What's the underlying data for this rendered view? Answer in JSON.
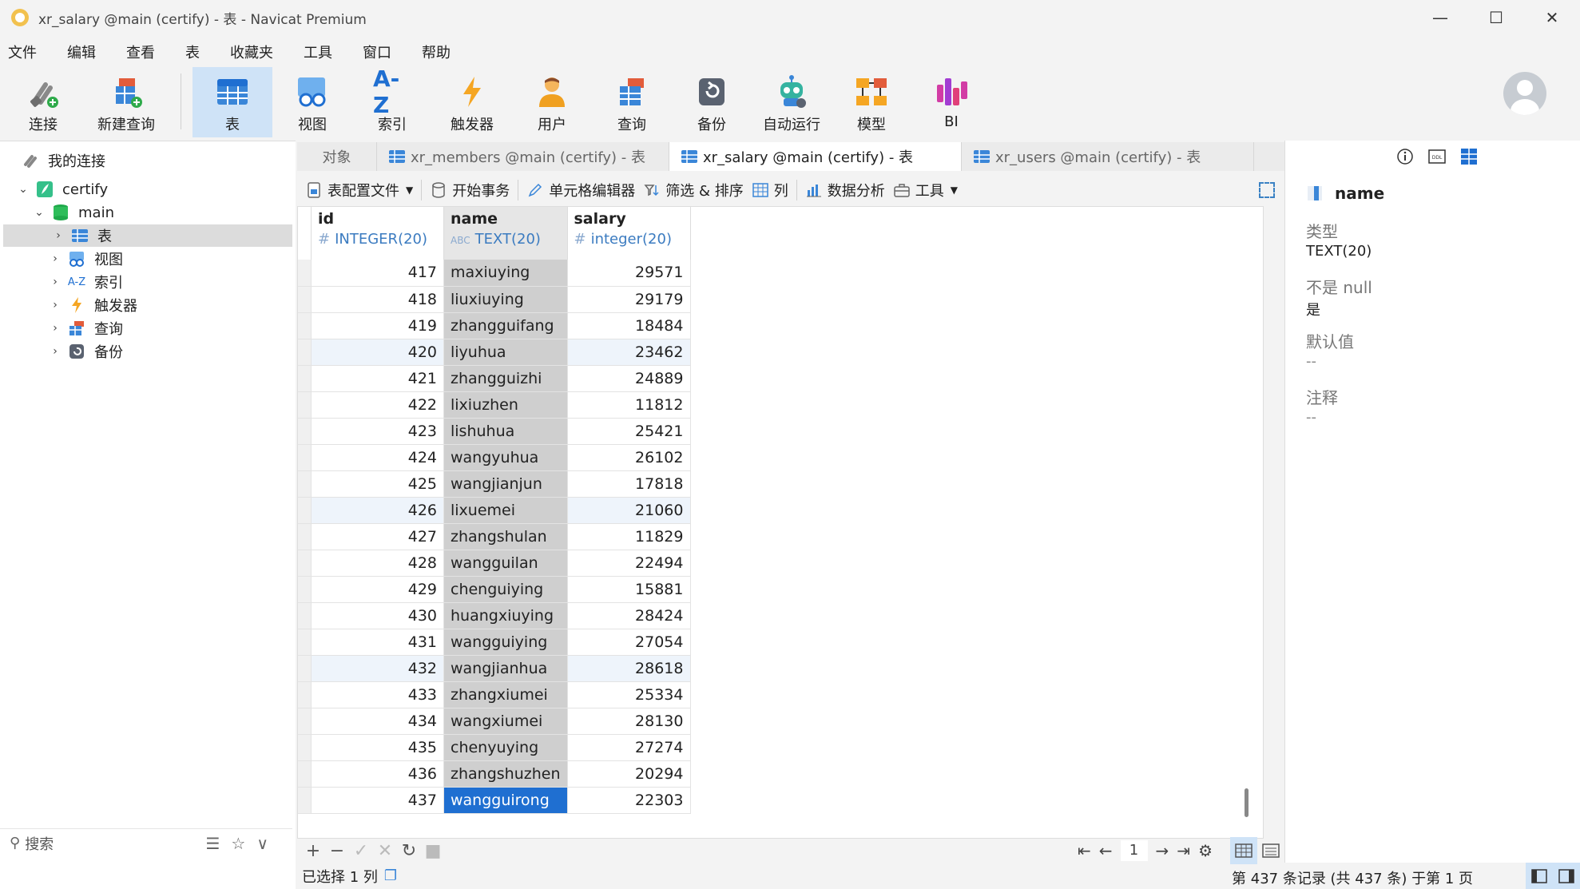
{
  "window": {
    "title": "xr_salary @main (certify) - 表 - Navicat Premium"
  },
  "menu": [
    "文件",
    "编辑",
    "查看",
    "表",
    "收藏夹",
    "工具",
    "窗口",
    "帮助"
  ],
  "toolbar": {
    "connect": "连接",
    "new_query": "新建查询",
    "table": "表",
    "view": "视图",
    "index": "索引",
    "trigger": "触发器",
    "user": "用户",
    "query": "查询",
    "backup": "备份",
    "automation": "自动运行",
    "model": "模型",
    "bi": "BI",
    "index_icon_text": "A-Z"
  },
  "sidebar": {
    "my_connections": "我的连接",
    "connection": "certify",
    "database": "main",
    "items": [
      {
        "label": "表"
      },
      {
        "label": "视图"
      },
      {
        "label": "索引"
      },
      {
        "label": "触发器"
      },
      {
        "label": "查询"
      },
      {
        "label": "备份"
      }
    ],
    "index_icon_text": "A-Z",
    "search_placeholder": "搜索"
  },
  "tabs": {
    "objects": "对象",
    "items": [
      {
        "label": "xr_members @main (certify) - 表"
      },
      {
        "label": "xr_salary @main (certify) - 表"
      },
      {
        "label": "xr_users @main (certify) - 表"
      }
    ]
  },
  "table_toolbar": {
    "config": "表配置文件",
    "begin_tx": "开始事务",
    "cell_editor": "单元格编辑器",
    "filter_sort": "筛选 & 排序",
    "columns": "列",
    "analysis": "数据分析",
    "tools": "工具"
  },
  "grid": {
    "columns": [
      {
        "name": "id",
        "type": "INTEGER(20)",
        "glyph": "#"
      },
      {
        "name": "name",
        "type": "TEXT(20)",
        "glyph": "ABC"
      },
      {
        "name": "salary",
        "type": "integer(20)",
        "glyph": "#"
      }
    ],
    "rows": [
      {
        "id": "417",
        "name": "maxiuying",
        "salary": "29571"
      },
      {
        "id": "418",
        "name": "liuxiuying",
        "salary": "29179"
      },
      {
        "id": "419",
        "name": "zhangguifang",
        "salary": "18484"
      },
      {
        "id": "420",
        "name": "liyuhua",
        "salary": "23462"
      },
      {
        "id": "421",
        "name": "zhangguizhi",
        "salary": "24889"
      },
      {
        "id": "422",
        "name": "lixiuzhen",
        "salary": "11812"
      },
      {
        "id": "423",
        "name": "lishuhua",
        "salary": "25421"
      },
      {
        "id": "424",
        "name": "wangyuhua",
        "salary": "26102"
      },
      {
        "id": "425",
        "name": "wangjianjun",
        "salary": "17818"
      },
      {
        "id": "426",
        "name": "lixuemei",
        "salary": "21060"
      },
      {
        "id": "427",
        "name": "zhangshulan",
        "salary": "11829"
      },
      {
        "id": "428",
        "name": "wangguilan",
        "salary": "22494"
      },
      {
        "id": "429",
        "name": "chenguiying",
        "salary": "15881"
      },
      {
        "id": "430",
        "name": "huangxiuying",
        "salary": "28424"
      },
      {
        "id": "431",
        "name": "wangguiying",
        "salary": "27054"
      },
      {
        "id": "432",
        "name": "wangjianhua",
        "salary": "28618"
      },
      {
        "id": "433",
        "name": "zhangxiumei",
        "salary": "25334"
      },
      {
        "id": "434",
        "name": "wangxiumei",
        "salary": "28130"
      },
      {
        "id": "435",
        "name": "chenyuying",
        "salary": "27274"
      },
      {
        "id": "436",
        "name": "zhangshuzhen",
        "salary": "20294"
      },
      {
        "id": "437",
        "name": "wangguirong",
        "salary": "22303"
      }
    ],
    "highlighted_ids": [
      "420",
      "426",
      "432"
    ],
    "selected_id": "437"
  },
  "pager": {
    "page": "1"
  },
  "status": {
    "selection": "已选择 1 列",
    "records": "第 437 条记录 (共 437 条) 于第 1 页"
  },
  "details": {
    "field_name": "name",
    "type_label": "类型",
    "type_value": "TEXT(20)",
    "notnull_label": "不是 null",
    "notnull_value": "是",
    "default_label": "默认值",
    "default_value": "--",
    "comment_label": "注释",
    "comment_value": "--",
    "ddl_icon_text": "DDL"
  },
  "colors": {
    "accent": "#1f6fd1",
    "active_tool": "#cfe3f7",
    "selected_column": "#cfcfcf"
  }
}
